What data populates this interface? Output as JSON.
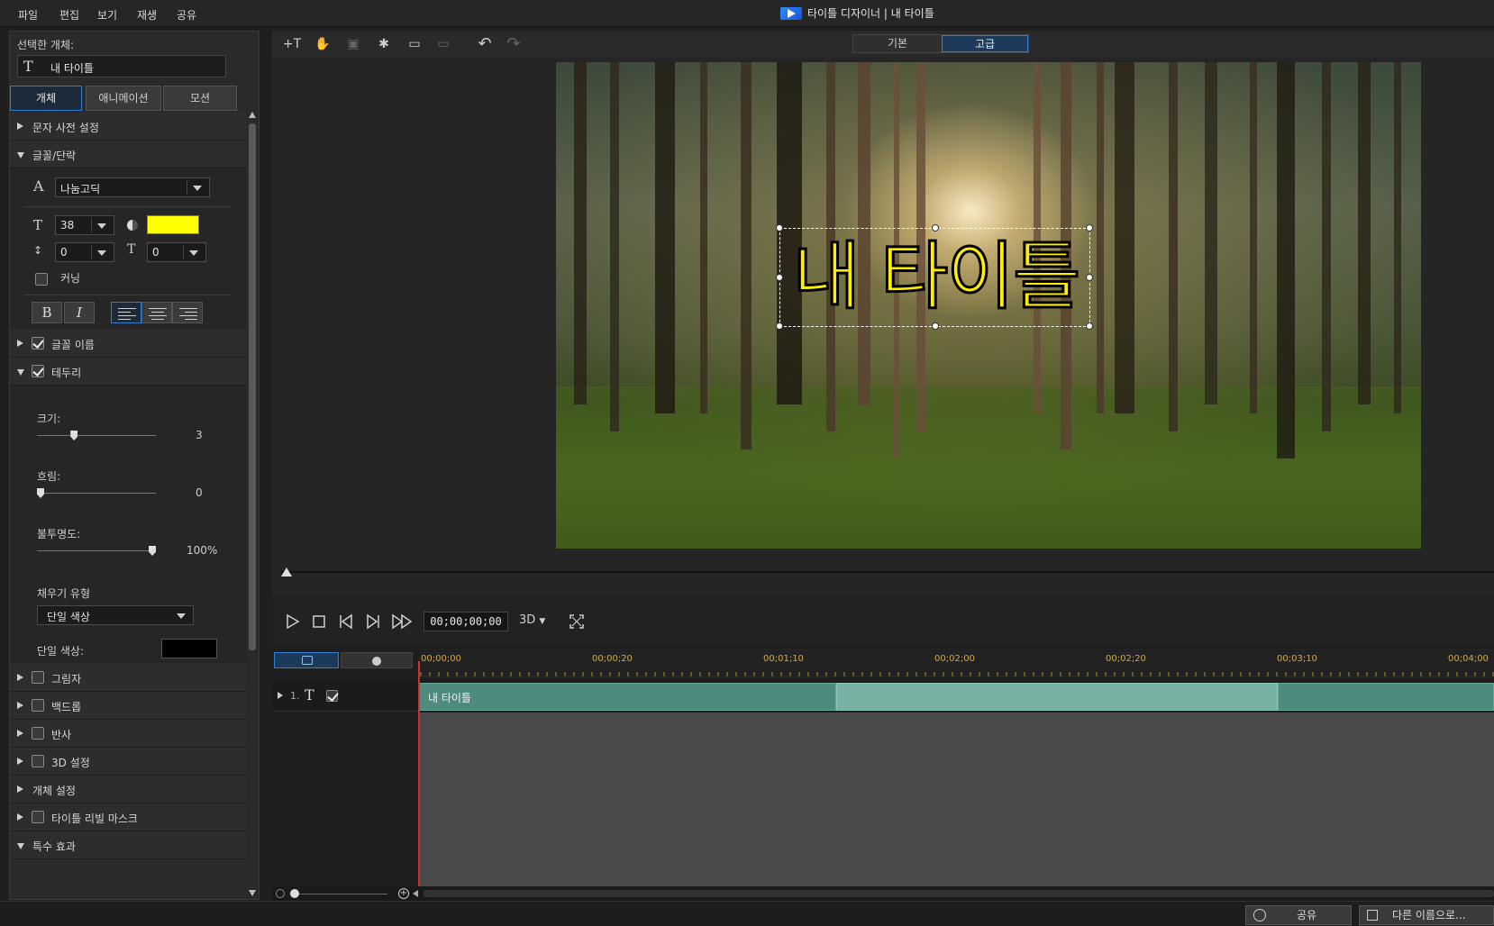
{
  "menu": [
    "파일",
    "편집",
    "보기",
    "재생",
    "공유"
  ],
  "window_title": "타이틀 디자이너  |  내 타이틀",
  "left": {
    "selected_label": "선택한 개체:",
    "selected_name": "내 타이틀",
    "tabs": [
      "개체",
      "애니메이션",
      "모션"
    ],
    "sections": {
      "char_preset": "문자 사전 설정",
      "font_para": "글꼴/단락",
      "font_name_sec": "글꼴 이름",
      "border": "테두리",
      "shadow": "그림자",
      "backdrop": "백드롭",
      "reflection": "반사",
      "settings3d": "3D 설정",
      "object_settings": "개체 설정",
      "reveal_mask": "타이틀 리빌 마스크",
      "special_fx": "특수 효과"
    },
    "font": {
      "family": "나눔고딕",
      "size": "38",
      "color": "#ffff00",
      "line_spacing": "0",
      "char_spacing": "0",
      "kerning_label": "커닝",
      "bold": "B",
      "italic": "I"
    },
    "border": {
      "size_label": "크기:",
      "size_value": "3",
      "size_pos": 0.3,
      "blur_label": "흐림:",
      "blur_value": "0",
      "blur_pos": 0,
      "opacity_label": "불투명도:",
      "opacity_value": "100%",
      "opacity_pos": 1,
      "fill_type_label": "채우기 유형",
      "fill_type_value": "단일 색상",
      "single_color_label": "단일 색상:",
      "single_color": "#000000"
    }
  },
  "toolbar": {
    "mode_basic": "기본",
    "mode_advanced": "고급"
  },
  "preview": {
    "title_text": "내 타이틀"
  },
  "playback": {
    "timecode": "00;00;00;00",
    "mode3d": "3D"
  },
  "timeline": {
    "ticks": [
      "00;00;00",
      "00;00;20",
      "00;01;10",
      "00;02;00",
      "00;02;20",
      "00;03;10",
      "00;04;00"
    ],
    "track_number": "1.",
    "clip_label": "내 타이틀"
  },
  "status": {
    "share": "공유",
    "save_as": "다른 이름으로..."
  }
}
